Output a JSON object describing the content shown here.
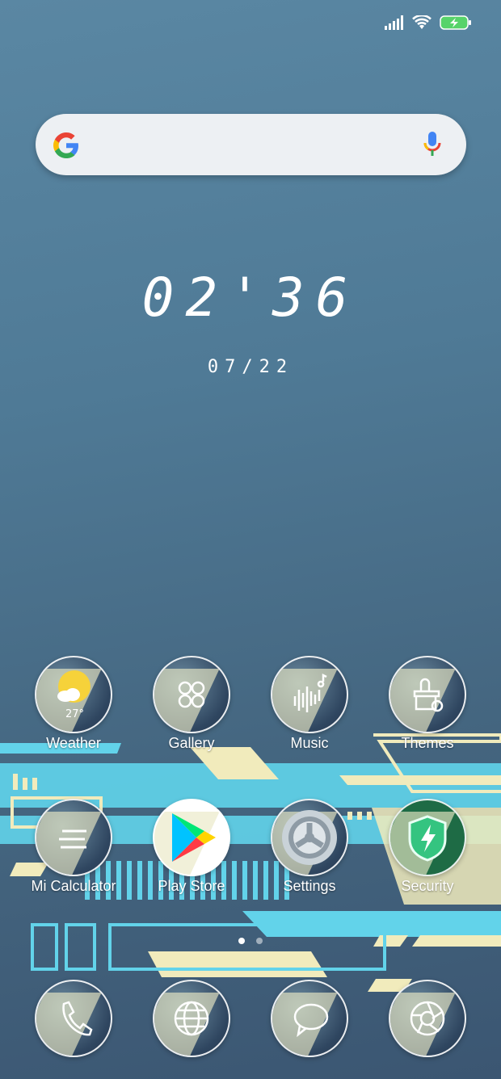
{
  "status_bar": {
    "signal_icon": "cell-signal-icon",
    "wifi_icon": "wifi-icon",
    "battery_icon": "battery-charging-icon",
    "battery_color": "#57d36a"
  },
  "search": {
    "logo_icon": "google-g-icon",
    "mic_icon": "microphone-icon"
  },
  "clock": {
    "time": "02'36",
    "date": "07/22"
  },
  "home_apps": [
    {
      "label": "Weather",
      "icon": "weather-icon",
      "temp": "27°"
    },
    {
      "label": "Gallery",
      "icon": "gallery-icon"
    },
    {
      "label": "Music",
      "icon": "music-icon"
    },
    {
      "label": "Themes",
      "icon": "themes-icon"
    },
    {
      "label": "Mi Calculator",
      "icon": "calculator-icon"
    },
    {
      "label": "Play Store",
      "icon": "play-store-icon"
    },
    {
      "label": "Settings",
      "icon": "settings-icon"
    },
    {
      "label": "Security",
      "icon": "security-icon"
    }
  ],
  "dock_apps": [
    {
      "icon": "phone-icon"
    },
    {
      "icon": "browser-icon"
    },
    {
      "icon": "messages-icon"
    },
    {
      "icon": "camera-icon"
    }
  ],
  "page_indicator": {
    "pages": 2,
    "current": 1
  },
  "colors": {
    "accent_cyan": "#62d3ea",
    "accent_cream": "#f1ebbc",
    "background": "#4f7a96"
  }
}
